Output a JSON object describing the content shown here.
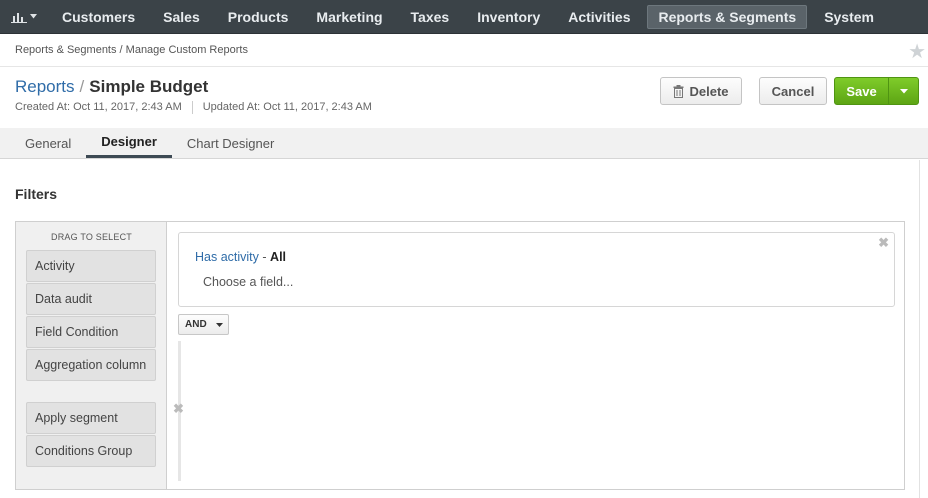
{
  "nav": {
    "logo_icon": "chart-bars-icon",
    "items": [
      "Customers",
      "Sales",
      "Products",
      "Marketing",
      "Taxes",
      "Inventory",
      "Activities",
      "Reports & Segments",
      "System"
    ],
    "active": "Reports & Segments"
  },
  "breadcrumb": "Reports & Segments / Manage Custom Reports",
  "header": {
    "parent_link": "Reports",
    "separator": "/",
    "entity_name": "Simple Budget",
    "created": "Created At: Oct 11, 2017, 2:43 AM",
    "updated": "Updated At: Oct 11, 2017, 2:43 AM"
  },
  "actions": {
    "delete_label": "Delete",
    "cancel_label": "Cancel",
    "save_label": "Save"
  },
  "tabs": [
    "General",
    "Designer",
    "Chart Designer"
  ],
  "active_tab": "Designer",
  "filters": {
    "title": "Filters",
    "palette_hint": "DRAG TO SELECT",
    "palette": [
      "Activity",
      "Data audit",
      "Field Condition",
      "Aggregation column",
      "Apply segment",
      "Conditions Group"
    ],
    "condition": {
      "link": "Has activity",
      "dash": "-",
      "value": "All",
      "choose": "Choose a field..."
    },
    "operator": "AND"
  },
  "colors": {
    "nav_bg": "#3b4348",
    "link": "#2f6ca8",
    "save_green": "#6bb81f"
  }
}
